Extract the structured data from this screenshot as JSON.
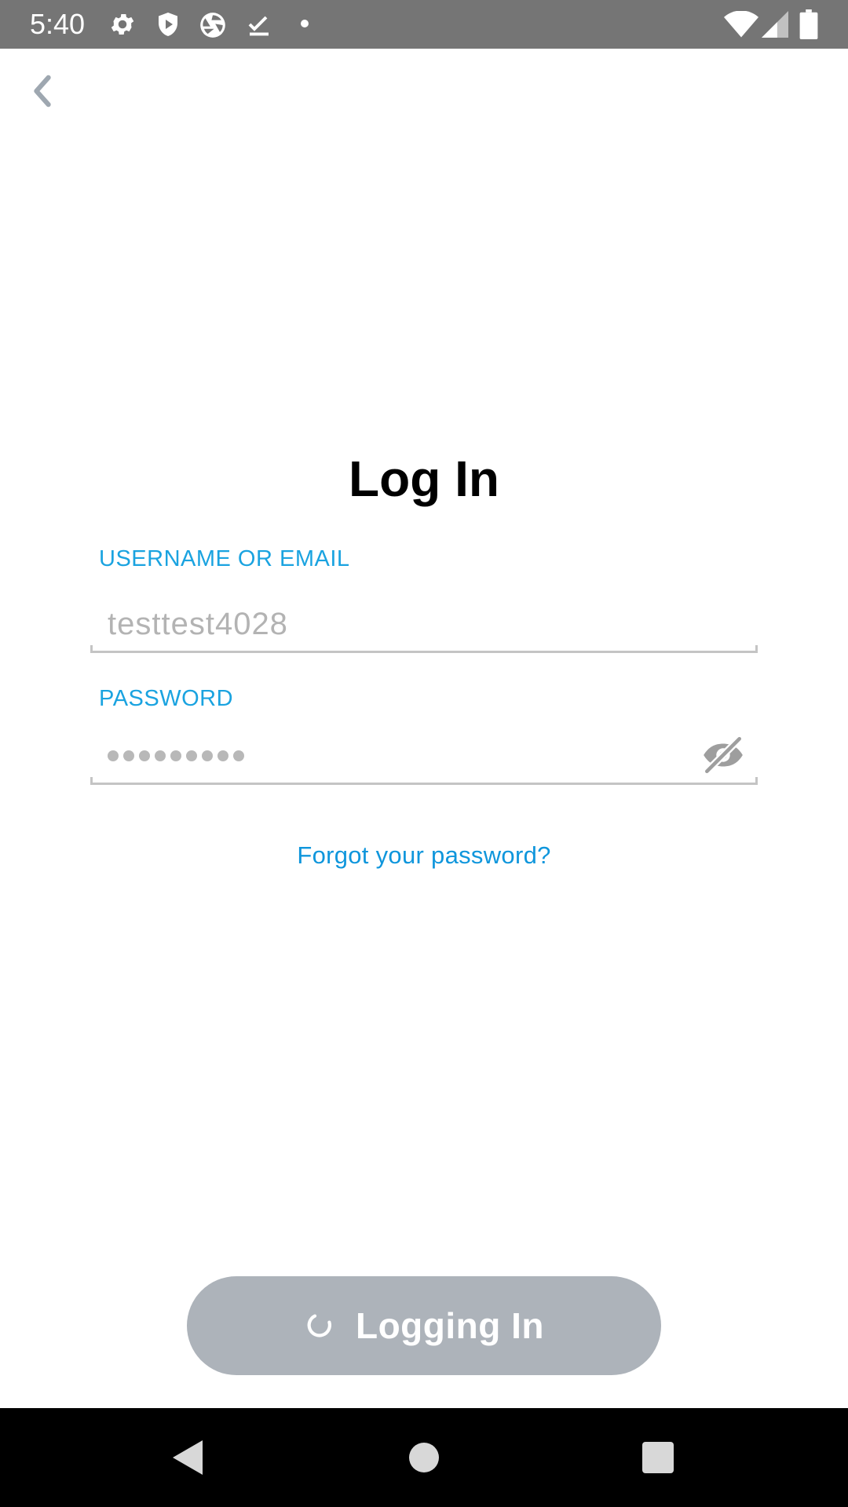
{
  "status_bar": {
    "time": "5:40",
    "left_icons": [
      "gear-icon",
      "shield-play-icon",
      "camera-aperture-icon",
      "download-done-icon",
      "dot-icon"
    ],
    "right_icons": [
      "wifi-icon",
      "cellular-signal-icon",
      "battery-icon"
    ],
    "background": "#757575"
  },
  "header": {
    "back_icon": "chevron-left-icon"
  },
  "form": {
    "title": "Log In",
    "username_label": "USERNAME OR EMAIL",
    "username_value": "testtest4028",
    "password_label": "PASSWORD",
    "password_masked_length": 9,
    "password_toggle_icon": "eye-off-icon",
    "forgot_link": "Forgot your password?"
  },
  "actions": {
    "login_button_label": "Logging In",
    "login_button_icon": "spinner-icon",
    "login_button_color": "#adb3ba"
  },
  "nav_bar": {
    "icons": [
      "back-triangle-icon",
      "home-circle-icon",
      "recents-square-icon"
    ]
  },
  "colors": {
    "accent": "#1aa3e0",
    "link": "#0f96dc",
    "field_value": "#b3b3b3",
    "underline": "#c4c4c4"
  }
}
